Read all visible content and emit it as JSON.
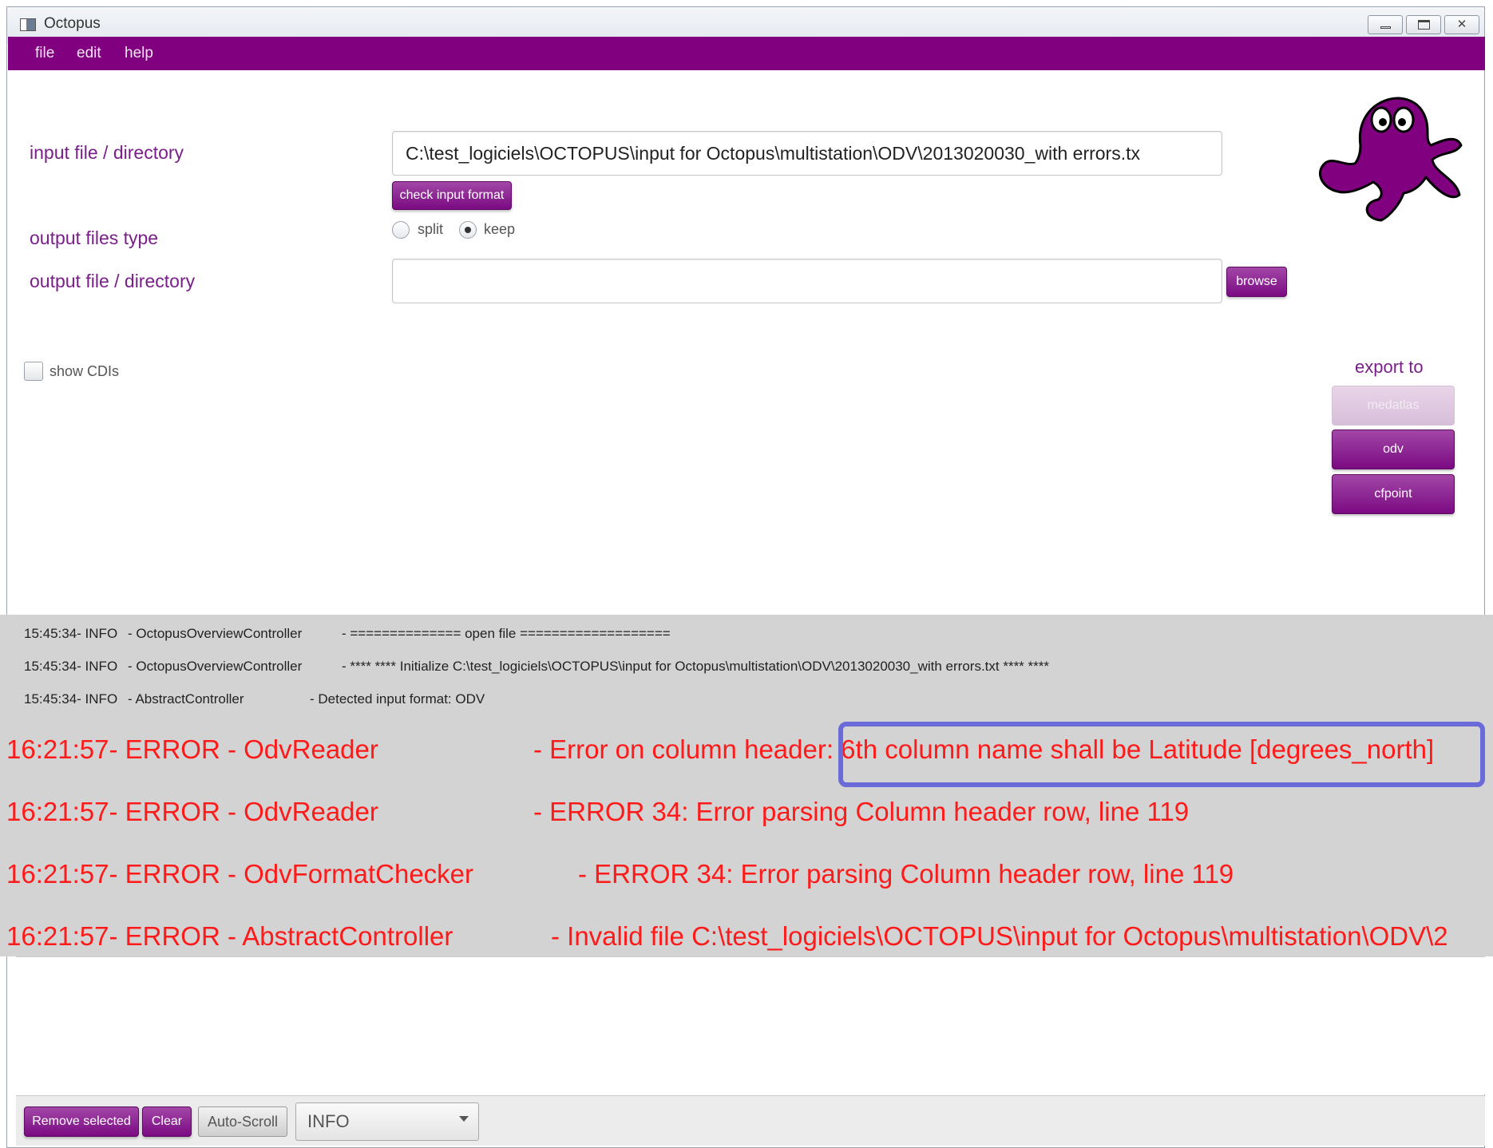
{
  "window": {
    "title": "Octopus"
  },
  "menu": {
    "file": "file",
    "edit": "edit",
    "help": "help"
  },
  "form": {
    "input_label": "input file / directory",
    "input_value": "C:\\test_logiciels\\OCTOPUS\\input for Octopus\\multistation\\ODV\\2013020030_with errors.tx",
    "check_button": "check input format",
    "output_type_label": "output files type",
    "split_label": "split",
    "keep_label": "keep",
    "output_label": "output file / directory",
    "output_value": "",
    "browse_button": "browse",
    "show_cdis_label": "show CDIs"
  },
  "export": {
    "title": "export to",
    "medatlas": "medatlas",
    "odv": "odv",
    "cfpoint": "cfpoint"
  },
  "log": {
    "info_rows": [
      {
        "time": "15:45:34- INFO",
        "source": "- OctopusOverviewController",
        "message": "- ============== open file ==================="
      },
      {
        "time": "15:45:34- INFO",
        "source": "- OctopusOverviewController",
        "message": "- **** **** Initialize C:\\test_logiciels\\OCTOPUS\\input for Octopus\\multistation\\ODV\\2013020030_with errors.txt **** ****"
      },
      {
        "time": "15:45:34- INFO",
        "source": "- AbstractController",
        "message": "- Detected input format: ODV"
      }
    ],
    "error_rows": [
      {
        "prefix": "16:21:57- ERROR - OdvReader",
        "message": "- Error on column header: 6th column name shall be Latitude [degrees_north]"
      },
      {
        "prefix": "16:21:57- ERROR - OdvReader",
        "message": "- ERROR 34: Error parsing Column header row, line 119"
      },
      {
        "prefix": "16:21:57- ERROR - OdvFormatChecker",
        "message": "- ERROR 34: Error parsing Column header row, line 119"
      },
      {
        "prefix": "16:21:57- ERROR - AbstractController",
        "message": "- Invalid file C:\\test_logiciels\\OCTOPUS\\input for Octopus\\multistation\\ODV\\2"
      }
    ]
  },
  "bottom": {
    "remove_selected": "Remove selected",
    "clear": "Clear",
    "auto_scroll": "Auto-Scroll",
    "level": "INFO"
  },
  "colors": {
    "accent": "#800080",
    "error_text": "#ff1a1a",
    "highlight_box": "#6a6ad8",
    "log_background": "#d3d3d3"
  }
}
